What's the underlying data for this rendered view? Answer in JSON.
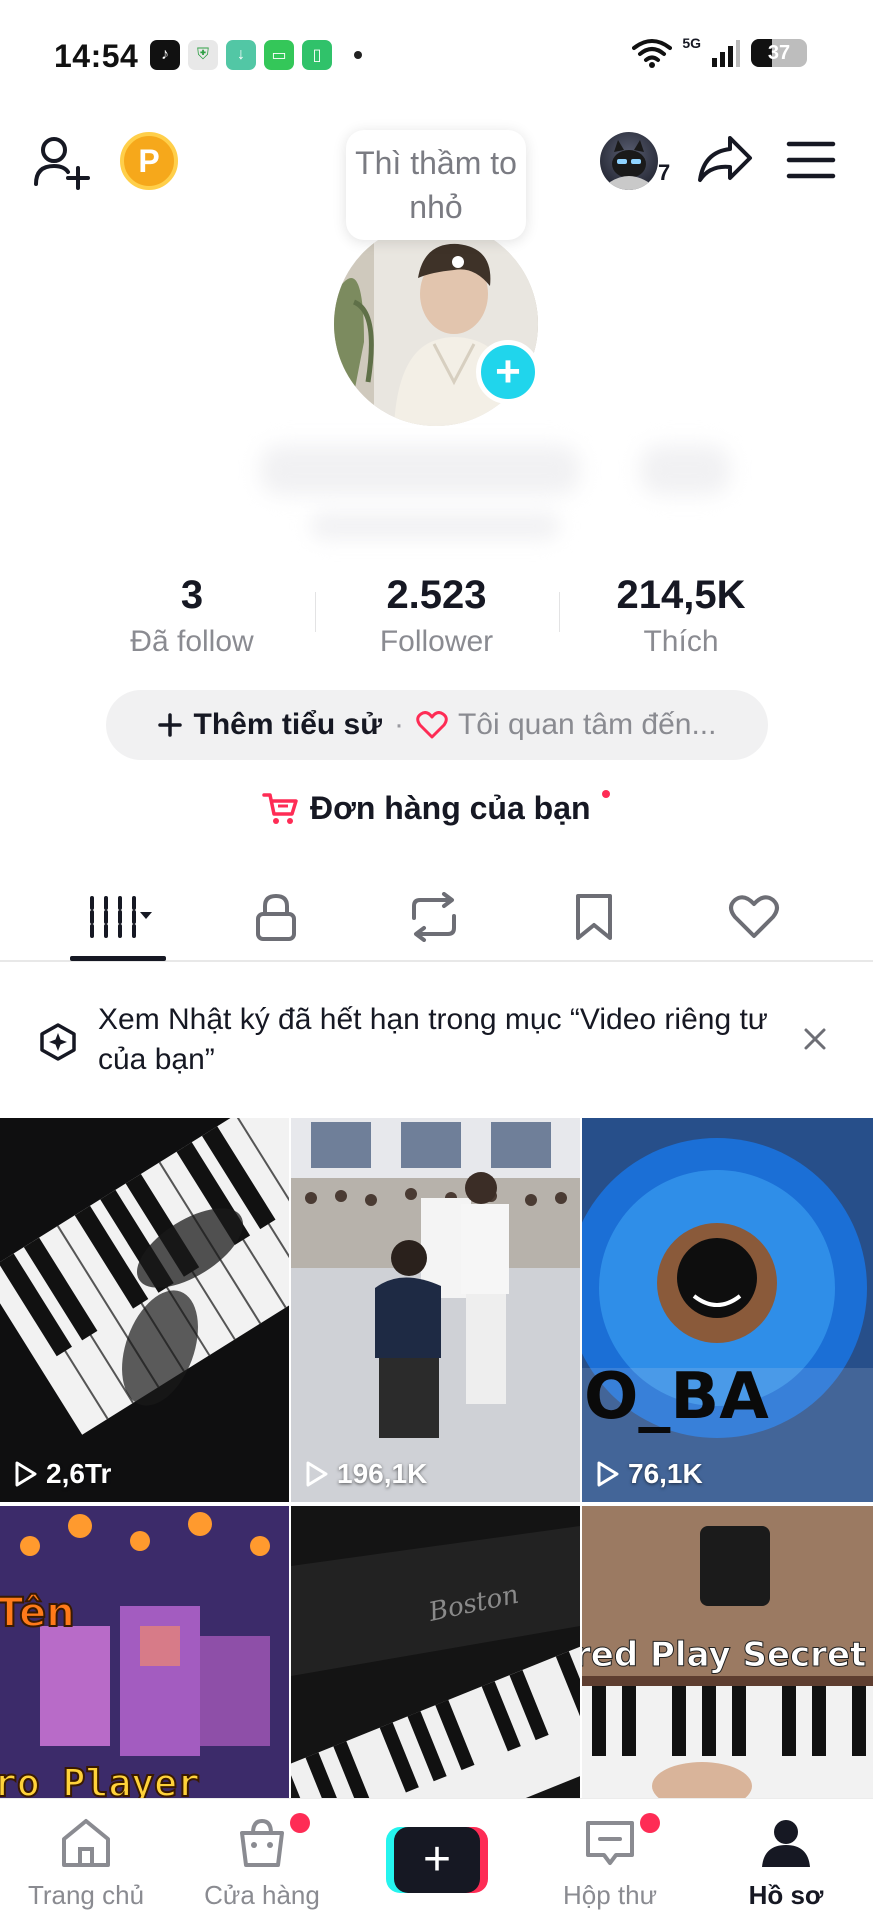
{
  "status_bar": {
    "time": "14:54",
    "network": "5G",
    "battery": "37",
    "battery_level": 0.37,
    "notification_icons": [
      "tiktok-icon",
      "shield-icon",
      "download-icon",
      "chat-icon",
      "battery-saver-icon"
    ]
  },
  "header": {
    "points_badge": "P",
    "tooltip": "Thì thầm to nhỏ",
    "friend_count": "7"
  },
  "stats": [
    {
      "value": "3",
      "label": "Đã follow"
    },
    {
      "value": "2.523",
      "label": "Follower"
    },
    {
      "value": "214,5K",
      "label": "Thích"
    }
  ],
  "bio": {
    "add_label": "Thêm tiểu sử",
    "separator": "·",
    "interest_label": "Tôi quan tâm đến..."
  },
  "orders": {
    "label": "Đơn hàng của bạn"
  },
  "notice": {
    "text": "Xem Nhật ký đã hết hạn trong mục “Video riêng tư của bạn”"
  },
  "videos": [
    {
      "views": "2,6Tr"
    },
    {
      "views": "196,1K"
    },
    {
      "views": "76,1K"
    },
    {
      "views": ""
    },
    {
      "views": ""
    },
    {
      "views": ""
    }
  ],
  "thumbnail_text": {
    "c3": "O_BA",
    "c4_top": "Tên",
    "c4_bottom": "ro Player",
    "c5": "Boston",
    "c6": "red Play Secret P"
  },
  "nav": [
    {
      "label": "Trang chủ"
    },
    {
      "label": "Cửa hàng"
    },
    {
      "label": ""
    },
    {
      "label": "Hộp thư"
    },
    {
      "label": "Hồ sơ"
    }
  ],
  "colors": {
    "accent": "#fe2c55",
    "cyan": "#25f4ee",
    "avatar_plus": "#20d5ec",
    "text": "#161823",
    "muted": "#8a8b91"
  }
}
